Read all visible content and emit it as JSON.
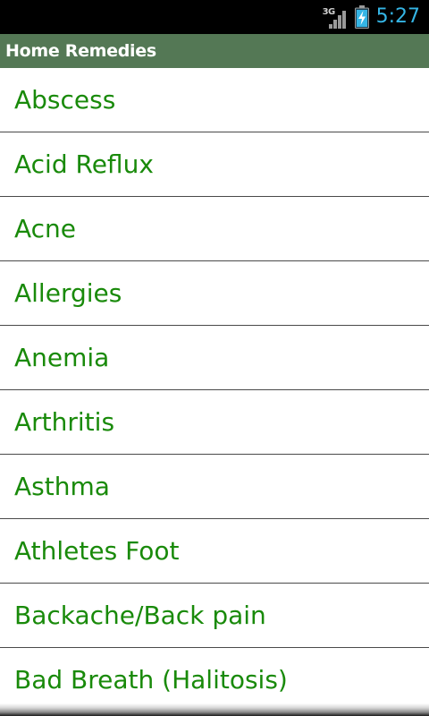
{
  "status_bar": {
    "network_type": "3G",
    "time": "5:27",
    "icons": [
      "signal-icon",
      "battery-charging-icon"
    ],
    "clock_color": "#35b5e5"
  },
  "title_bar": {
    "title": "Home Remedies",
    "background_color": "#547855"
  },
  "list": {
    "text_color": "#198a0a",
    "items": [
      {
        "label": "Abscess"
      },
      {
        "label": "Acid Reflux"
      },
      {
        "label": "Acne"
      },
      {
        "label": "Allergies"
      },
      {
        "label": "Anemia"
      },
      {
        "label": "Arthritis"
      },
      {
        "label": "Asthma"
      },
      {
        "label": "Athletes Foot"
      },
      {
        "label": "Backache/Back pain"
      },
      {
        "label": "Bad Breath (Halitosis)"
      }
    ]
  }
}
